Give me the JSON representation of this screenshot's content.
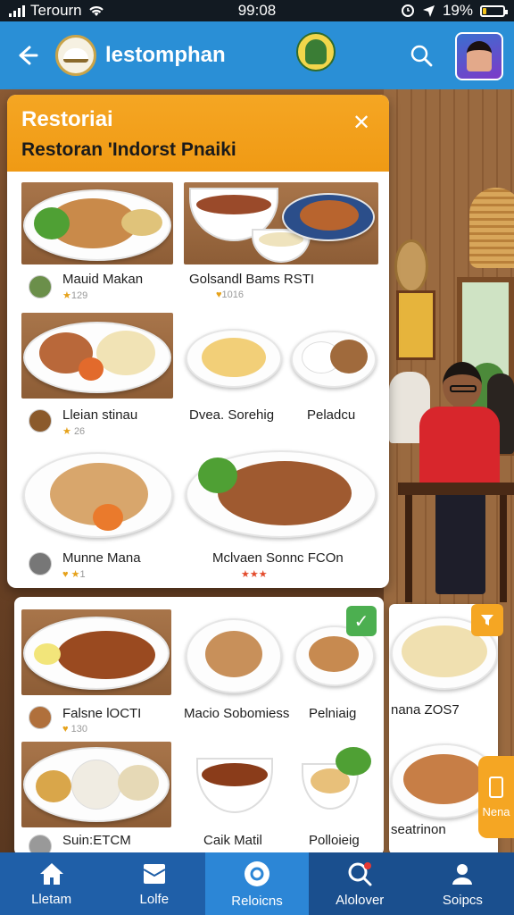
{
  "status_bar": {
    "carrier": "Terourn",
    "time": "99:08",
    "battery": "19%",
    "battery_level": 0.19
  },
  "header": {
    "title": "lestomphan",
    "back_icon": "back-arrow-icon",
    "search_icon": "search-icon"
  },
  "card": {
    "title": "Restoriai",
    "subtitle": "Restoran 'Indorst Pnaiki",
    "close_icon": "close-icon",
    "items": [
      {
        "label": "Mauid Makan",
        "rating": "129",
        "star": "★"
      },
      {
        "label": "Golsandl Bams RSTI",
        "rating": "1016",
        "star": "♥"
      },
      {
        "label": "Lleian stinau",
        "rating": "26",
        "star": "★"
      },
      {
        "label": "Dvea. Sorehig",
        "rating": "",
        "star": ""
      },
      {
        "label": "Peladcu",
        "rating": "",
        "star": ""
      },
      {
        "label": "Munne Mana",
        "rating": "1",
        "star": "♥ ★"
      },
      {
        "label": "Mclvaen Sonnc FCOn",
        "rating": "",
        "star": "★★★"
      }
    ]
  },
  "card2": {
    "check_icon": "check-icon",
    "items": [
      {
        "label": "Falsne lOCTI",
        "rating": "130",
        "star": "♥"
      },
      {
        "label": "Macio Sobomiess",
        "rating": "",
        "star": ""
      },
      {
        "label": "Pelniaig",
        "rating": "",
        "star": ""
      },
      {
        "label": "Suin:ETCM",
        "rating": "",
        "star": ""
      },
      {
        "label": "Caik Matil",
        "rating": "",
        "star": ""
      },
      {
        "label": "Polloieig",
        "rating": "",
        "star": ""
      }
    ]
  },
  "peek": {
    "label1": "nana ZOS7",
    "label2": "seatrinon",
    "filter_icon": "filter-icon",
    "side_tab_label": "Nena"
  },
  "bottom_nav": [
    {
      "label": "Lletam",
      "icon": "home-icon"
    },
    {
      "label": "Lolfe",
      "icon": "menu-icon"
    },
    {
      "label": "Reloicns",
      "icon": "location-icon"
    },
    {
      "label": "Alolover",
      "icon": "search-icon"
    },
    {
      "label": "Soipcs",
      "icon": "profile-icon"
    }
  ],
  "colors": {
    "header_blue": "#2a8fd6",
    "accent_orange": "#f5a623",
    "nav_blue": "#1f5fa8",
    "check_green": "#4caf50"
  }
}
